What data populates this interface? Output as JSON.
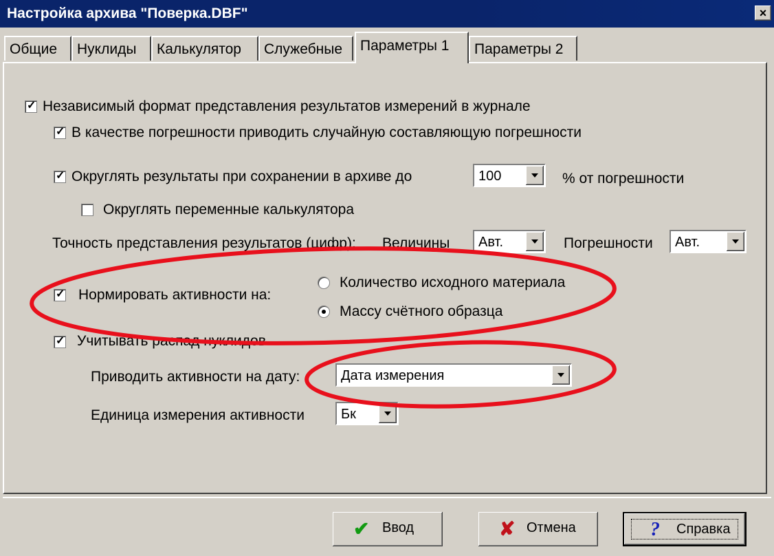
{
  "window": {
    "title": "Настройка архива \"Поверка.DBF\"",
    "close": "×"
  },
  "tabs": [
    "Общие",
    "Нуклиды",
    "Калькулятор",
    "Служебные",
    "Параметры 1",
    "Параметры 2"
  ],
  "active_tab": "Параметры 1",
  "options": {
    "independent_format": {
      "label": "Независимый формат представления результатов измерений в журнале",
      "checked": true
    },
    "random_error": {
      "label": "В качестве погрешности приводить случайную составляющую погрешности",
      "checked": true
    },
    "round_results": {
      "label": "Округлять результаты  при сохранении в архиве до",
      "checked": true,
      "value": "100",
      "suffix": "% от погрешности"
    },
    "round_calc": {
      "label": "Округлять переменные калькулятора",
      "checked": false
    },
    "precision": {
      "label": "Точность представления результатов (цифр):",
      "values_label": "Величины",
      "values_value": "Авт.",
      "errors_label": "Погрешности",
      "errors_value": "Авт."
    },
    "normalize": {
      "label": "Нормировать активности на:",
      "checked": true,
      "radio1": "Количество исходного материала",
      "radio2": "Массу счётного образца",
      "selected": 2
    },
    "decay": {
      "label": "Учитывать распад нуклидов",
      "checked": true
    },
    "date": {
      "label": "Приводить активности на дату:",
      "value": "Дата измерения"
    },
    "unit": {
      "label": "Единица измерения активности",
      "value": "Бк"
    }
  },
  "buttons": {
    "ok": "Ввод",
    "cancel": "Отмена",
    "help": "Справка"
  },
  "annotation_color": "#e8101c"
}
